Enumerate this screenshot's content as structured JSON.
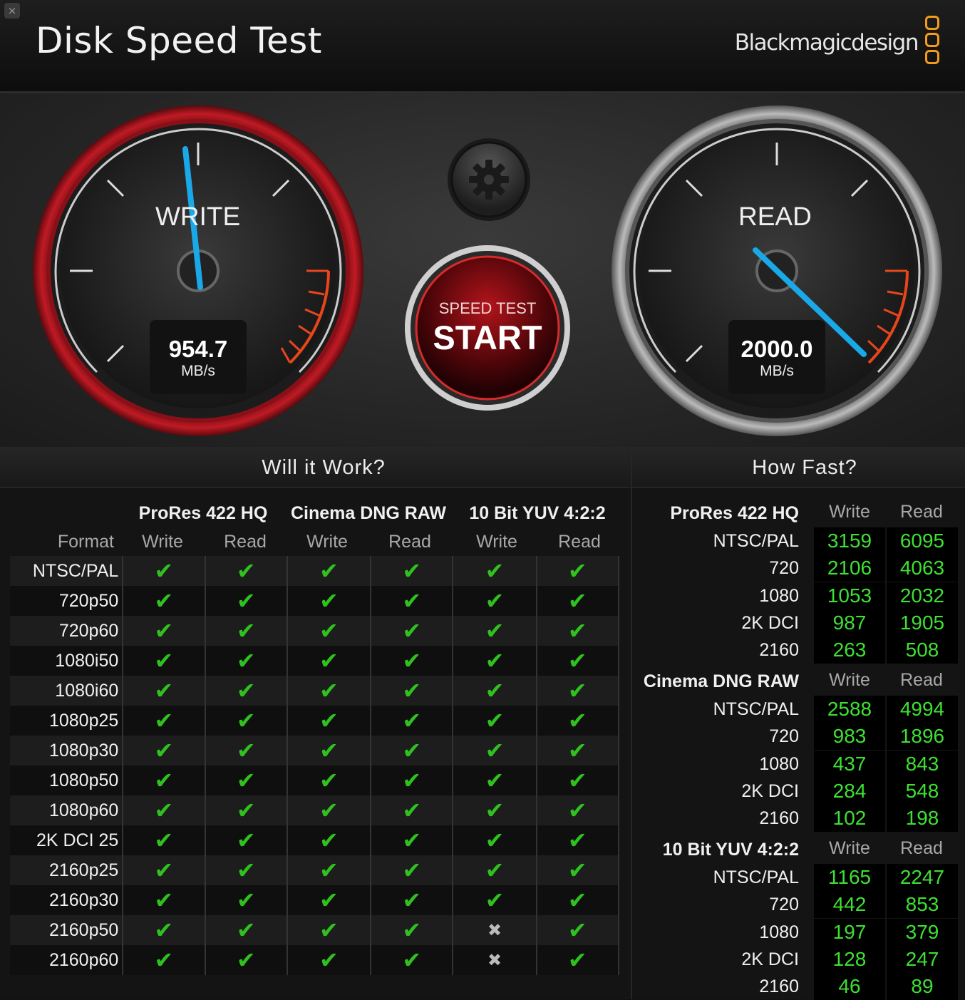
{
  "window": {
    "close_label": "×"
  },
  "header": {
    "title": "Disk Speed Test",
    "brand": "Blackmagicdesign"
  },
  "gauges": {
    "write": {
      "label": "WRITE",
      "value": "954.7",
      "unit": "MB/s"
    },
    "read": {
      "label": "READ",
      "value": "2000.0",
      "unit": "MB/s"
    },
    "start": {
      "top_label": "SPEED TEST",
      "main_label": "START"
    },
    "settings_icon": "gear-icon"
  },
  "will_it_work": {
    "title": "Will it Work?",
    "format_header": "Format",
    "codecs": [
      "ProRes 422 HQ",
      "Cinema DNG RAW",
      "10 Bit YUV 4:2:2"
    ],
    "sub_headers": [
      "Write",
      "Read",
      "Write",
      "Read",
      "Write",
      "Read"
    ],
    "rows": [
      {
        "format": "NTSC/PAL",
        "cells": [
          "check",
          "check",
          "check",
          "check",
          "check",
          "check"
        ]
      },
      {
        "format": "720p50",
        "cells": [
          "check",
          "check",
          "check",
          "check",
          "check",
          "check"
        ]
      },
      {
        "format": "720p60",
        "cells": [
          "check",
          "check",
          "check",
          "check",
          "check",
          "check"
        ]
      },
      {
        "format": "1080i50",
        "cells": [
          "check",
          "check",
          "check",
          "check",
          "check",
          "check"
        ]
      },
      {
        "format": "1080i60",
        "cells": [
          "check",
          "check",
          "check",
          "check",
          "check",
          "check"
        ]
      },
      {
        "format": "1080p25",
        "cells": [
          "check",
          "check",
          "check",
          "check",
          "check",
          "check"
        ]
      },
      {
        "format": "1080p30",
        "cells": [
          "check",
          "check",
          "check",
          "check",
          "check",
          "check"
        ]
      },
      {
        "format": "1080p50",
        "cells": [
          "check",
          "check",
          "check",
          "check",
          "check",
          "check"
        ]
      },
      {
        "format": "1080p60",
        "cells": [
          "check",
          "check",
          "check",
          "check",
          "check",
          "check"
        ]
      },
      {
        "format": "2K DCI 25",
        "cells": [
          "check",
          "check",
          "check",
          "check",
          "check",
          "check"
        ]
      },
      {
        "format": "2160p25",
        "cells": [
          "check",
          "check",
          "check",
          "check",
          "check",
          "check"
        ]
      },
      {
        "format": "2160p30",
        "cells": [
          "check",
          "check",
          "check",
          "check",
          "check",
          "check"
        ]
      },
      {
        "format": "2160p50",
        "cells": [
          "check",
          "check",
          "check",
          "check",
          "cross",
          "check"
        ]
      },
      {
        "format": "2160p60",
        "cells": [
          "check",
          "check",
          "check",
          "check",
          "cross",
          "check"
        ]
      }
    ],
    "check_glyph": "✔",
    "cross_glyph": "✖"
  },
  "how_fast": {
    "title": "How Fast?",
    "groups": [
      {
        "codec": "ProRes 422 HQ",
        "write_label": "Write",
        "read_label": "Read",
        "rows": [
          {
            "format": "NTSC/PAL",
            "write": "3159",
            "read": "6095"
          },
          {
            "format": "720",
            "write": "2106",
            "read": "4063"
          },
          {
            "format": "1080",
            "write": "1053",
            "read": "2032"
          },
          {
            "format": "2K DCI",
            "write": "987",
            "read": "1905"
          },
          {
            "format": "2160",
            "write": "263",
            "read": "508"
          }
        ]
      },
      {
        "codec": "Cinema DNG RAW",
        "write_label": "Write",
        "read_label": "Read",
        "rows": [
          {
            "format": "NTSC/PAL",
            "write": "2588",
            "read": "4994"
          },
          {
            "format": "720",
            "write": "983",
            "read": "1896"
          },
          {
            "format": "1080",
            "write": "437",
            "read": "843"
          },
          {
            "format": "2K DCI",
            "write": "284",
            "read": "548"
          },
          {
            "format": "2160",
            "write": "102",
            "read": "198"
          }
        ]
      },
      {
        "codec": "10 Bit YUV 4:2:2",
        "write_label": "Write",
        "read_label": "Read",
        "rows": [
          {
            "format": "NTSC/PAL",
            "write": "1165",
            "read": "2247"
          },
          {
            "format": "720",
            "write": "442",
            "read": "853"
          },
          {
            "format": "1080",
            "write": "197",
            "read": "379"
          },
          {
            "format": "2K DCI",
            "write": "128",
            "read": "247"
          },
          {
            "format": "2160",
            "write": "46",
            "read": "89"
          }
        ]
      }
    ]
  },
  "colors": {
    "accent_orange": "#f29b1c",
    "needle_blue": "#1aa9e8",
    "check_green": "#2fc21f",
    "value_green": "#3ee032",
    "write_ring_red": "#b01822"
  }
}
